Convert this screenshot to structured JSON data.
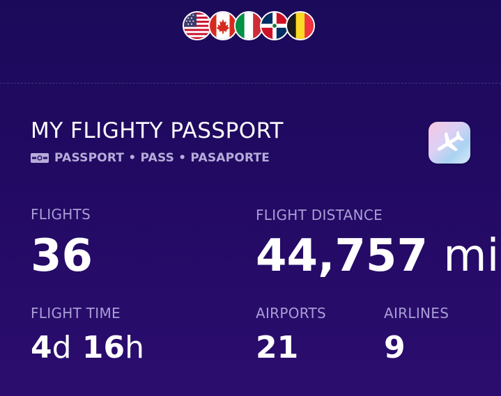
{
  "flags": [
    {
      "icon": "us-flag-icon"
    },
    {
      "icon": "canada-flag-icon"
    },
    {
      "icon": "italy-flag-icon"
    },
    {
      "icon": "dominican-republic-flag-icon"
    },
    {
      "icon": "belgium-flag-icon"
    }
  ],
  "passport": {
    "title": "MY FLIGHTY PASSPORT",
    "subtitle": "PASSPORT • PASS • PASAPORTE",
    "app_icon": "airplane-app-icon"
  },
  "stats": {
    "flights": {
      "label": "FLIGHTS",
      "value": "36"
    },
    "distance": {
      "label": "FLIGHT DISTANCE",
      "value": "44,757",
      "unit": "mi"
    },
    "time": {
      "label": "FLIGHT TIME",
      "days": "4",
      "days_unit": "d",
      "hours": "16",
      "hours_unit": "h"
    },
    "airports": {
      "label": "AIRPORTS",
      "value": "21"
    },
    "airlines": {
      "label": "AIRLINES",
      "value": "9"
    }
  },
  "colors": {
    "background": "#220a63",
    "label": "#a99ed6",
    "subtitle": "#b7acd9"
  }
}
